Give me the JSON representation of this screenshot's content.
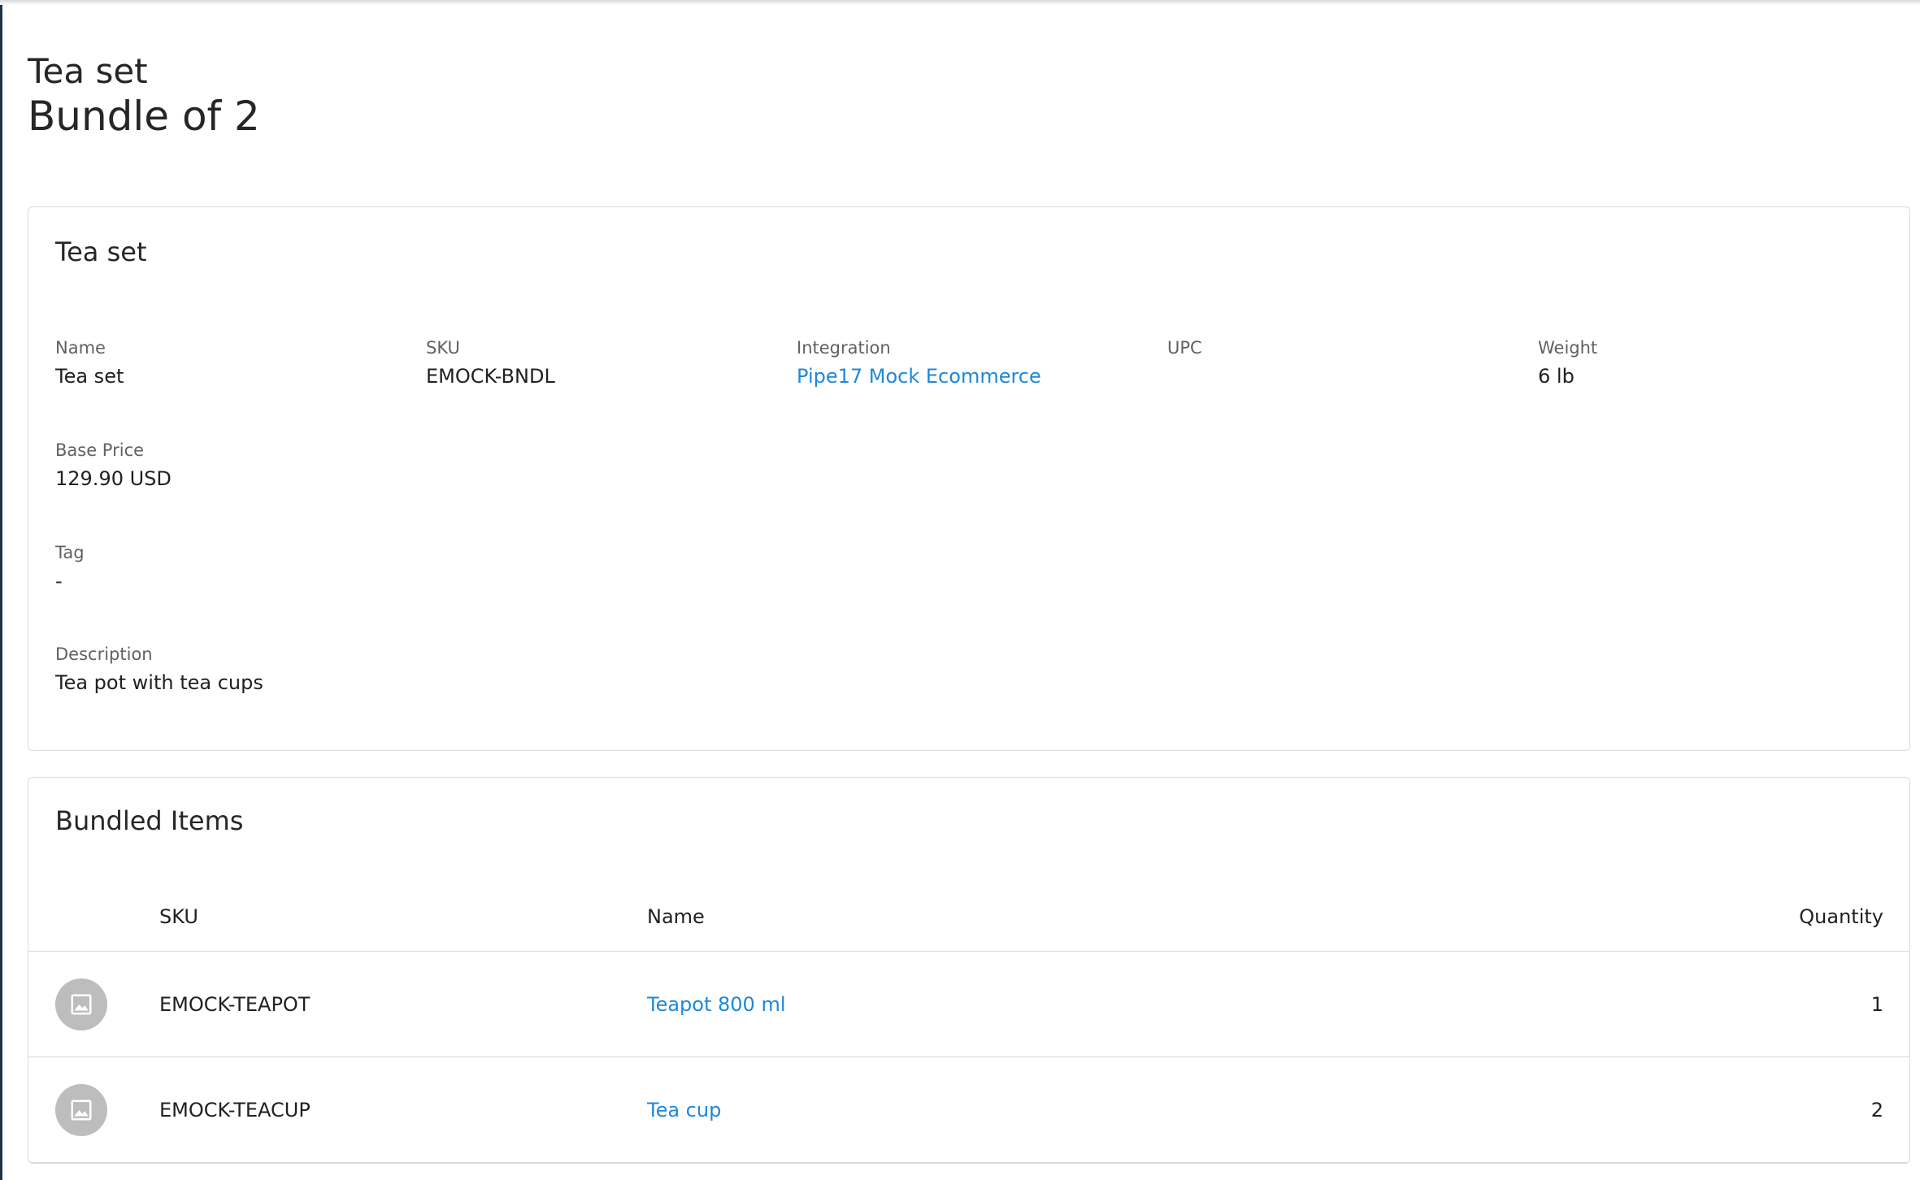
{
  "header": {
    "title": "Tea set",
    "subtitle": "Bundle of 2"
  },
  "details": {
    "card_title": "Tea set",
    "fields": {
      "name": {
        "label": "Name",
        "value": "Tea set"
      },
      "sku": {
        "label": "SKU",
        "value": "EMOCK-BNDL"
      },
      "integration": {
        "label": "Integration",
        "value": "Pipe17 Mock Ecommerce"
      },
      "upc": {
        "label": "UPC",
        "value": ""
      },
      "weight": {
        "label": "Weight",
        "value": "6 lb"
      },
      "base_price": {
        "label": "Base Price",
        "value": "129.90 USD"
      },
      "tag": {
        "label": "Tag",
        "value": "-"
      },
      "description": {
        "label": "Description",
        "value": "Tea pot with tea cups"
      }
    }
  },
  "bundle": {
    "card_title": "Bundled Items",
    "columns": {
      "sku": "SKU",
      "name": "Name",
      "quantity": "Quantity"
    },
    "rows": [
      {
        "sku": "EMOCK-TEAPOT",
        "name": "Teapot 800 ml",
        "quantity": "1",
        "icon": "image-placeholder-icon"
      },
      {
        "sku": "EMOCK-TEACUP",
        "name": "Tea cup",
        "quantity": "2",
        "icon": "image-placeholder-icon"
      }
    ]
  },
  "colors": {
    "link": "#1e88d9",
    "thumb": "#bdbdbd",
    "sidebar_edge": "#1f3347"
  }
}
